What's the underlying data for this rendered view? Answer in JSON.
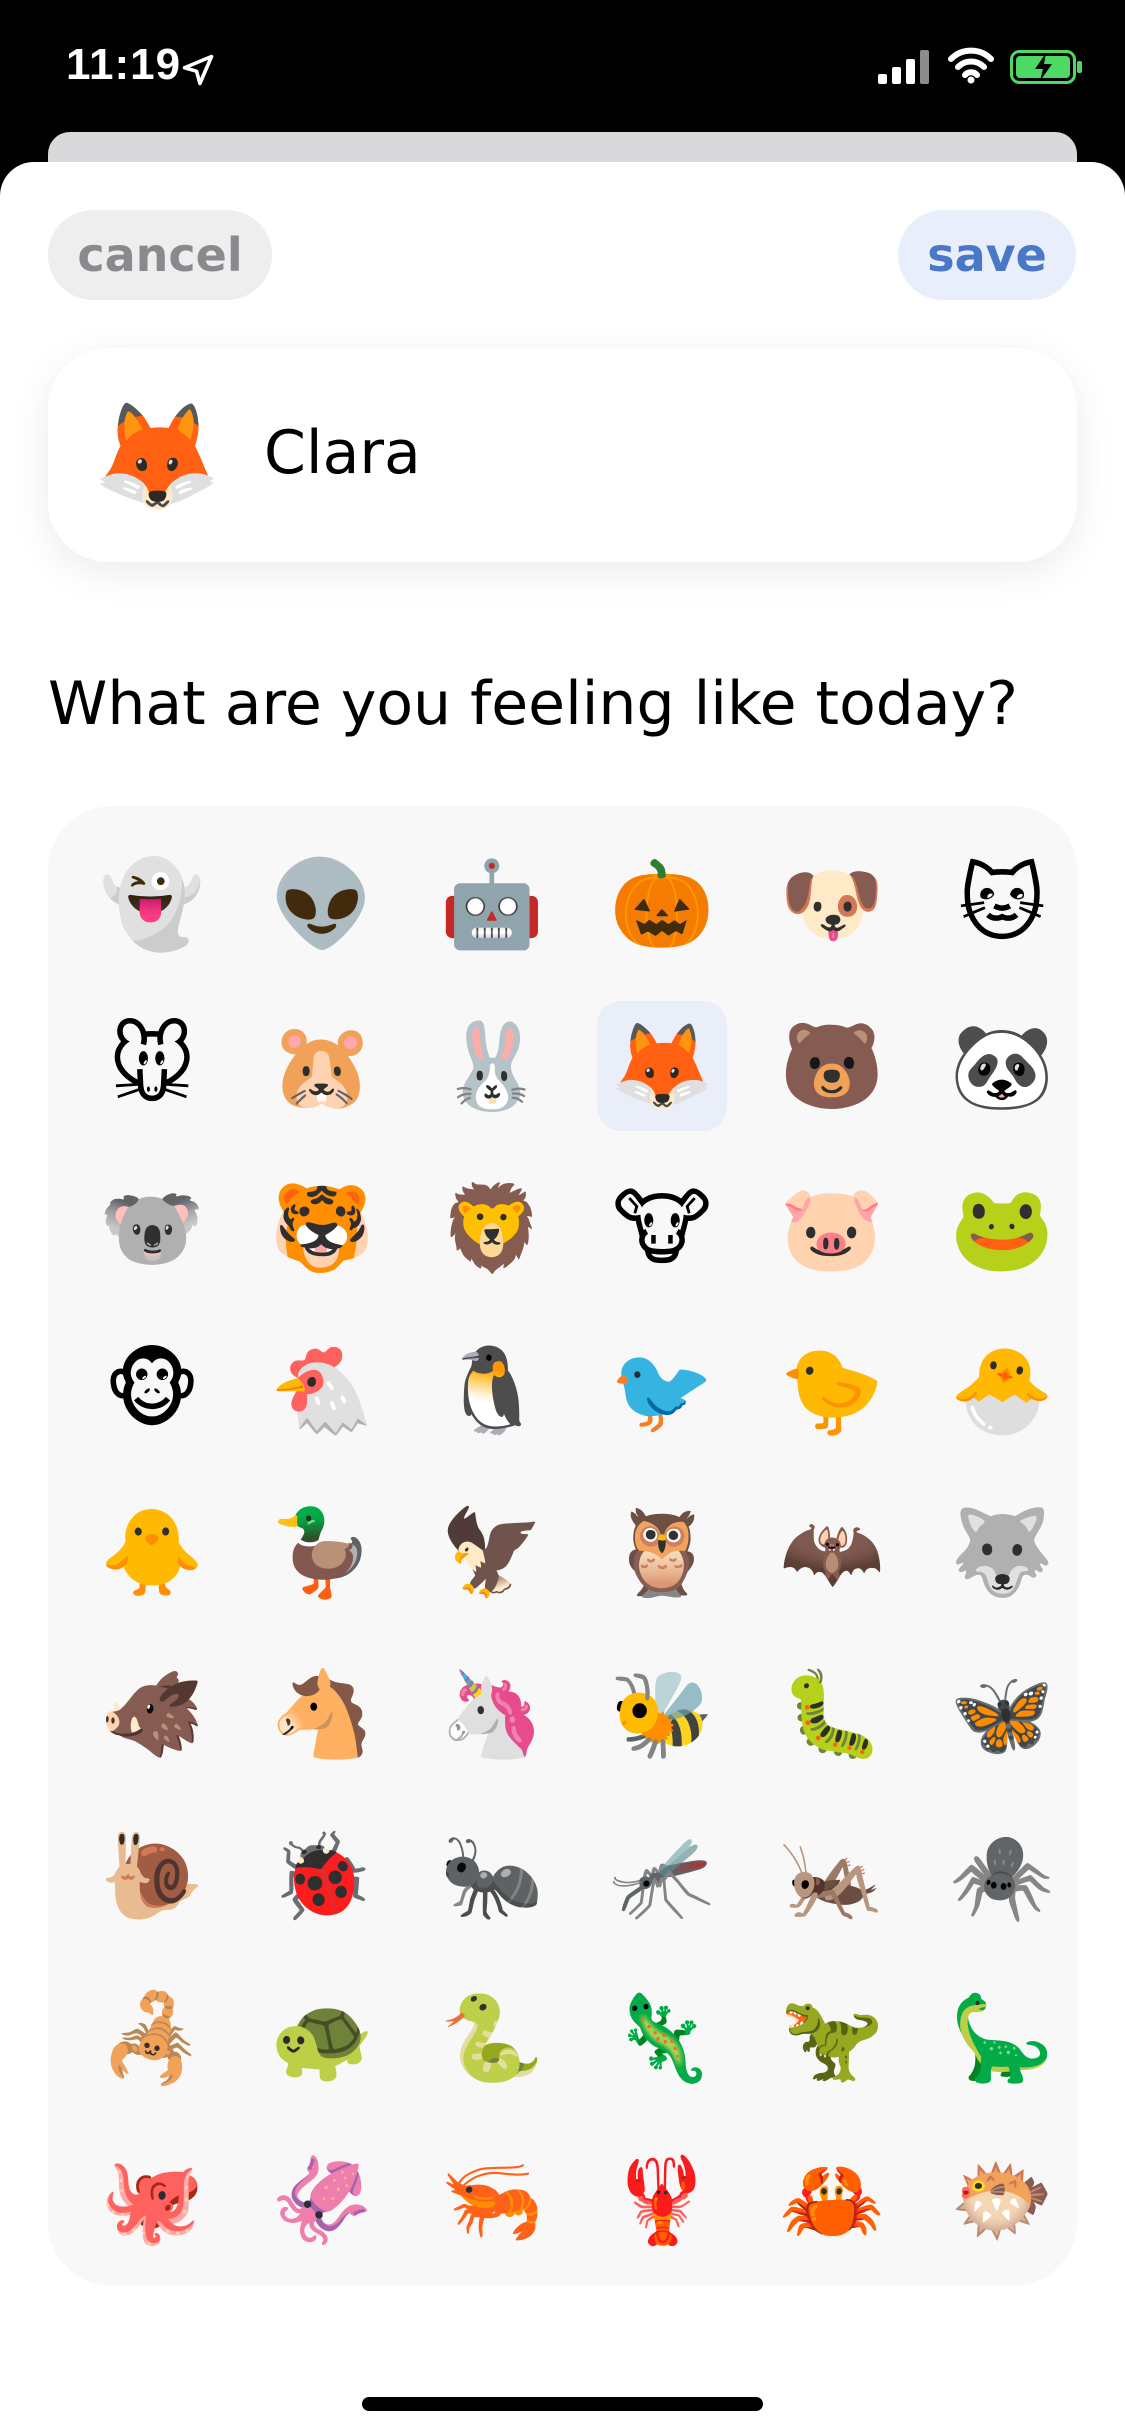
{
  "status_bar": {
    "time": "11:19",
    "location_icon": "location-arrow-icon",
    "signal_icon": "cellular-signal-icon",
    "wifi_icon": "wifi-icon",
    "battery_icon": "battery-charging-icon",
    "battery_color": "#4cd964"
  },
  "header": {
    "cancel_label": "cancel",
    "save_label": "save",
    "save_color": "#4a78c8"
  },
  "profile": {
    "emoji": "🦊",
    "name": "Clara"
  },
  "prompt": {
    "question": "What are you feeling like today?"
  },
  "emoji_grid": {
    "selected_index": 9,
    "selected_color": "#e9eef8",
    "items": [
      "👻",
      "👽",
      "🤖",
      "🎃",
      "🐶",
      "🐱",
      "🐭",
      "🐹",
      "🐰",
      "🦊",
      "🐻",
      "🐼",
      "🐨",
      "🐯",
      "🦁",
      "🐮",
      "🐷",
      "🐸",
      "🐵",
      "🐔",
      "🐧",
      "🐦",
      "🐤",
      "🐣",
      "🐥",
      "🦆",
      "🦅",
      "🦉",
      "🦇",
      "🐺",
      "🐗",
      "🐴",
      "🦄",
      "🐝",
      "🐛",
      "🦋",
      "🐌",
      "🐞",
      "🐜",
      "🦟",
      "🦗",
      "🕷️",
      "🦂",
      "🐢",
      "🐍",
      "🦎",
      "🦖",
      "🦕",
      "🐙",
      "🦑",
      "🦐",
      "🦞",
      "🦀",
      "🐡"
    ]
  }
}
